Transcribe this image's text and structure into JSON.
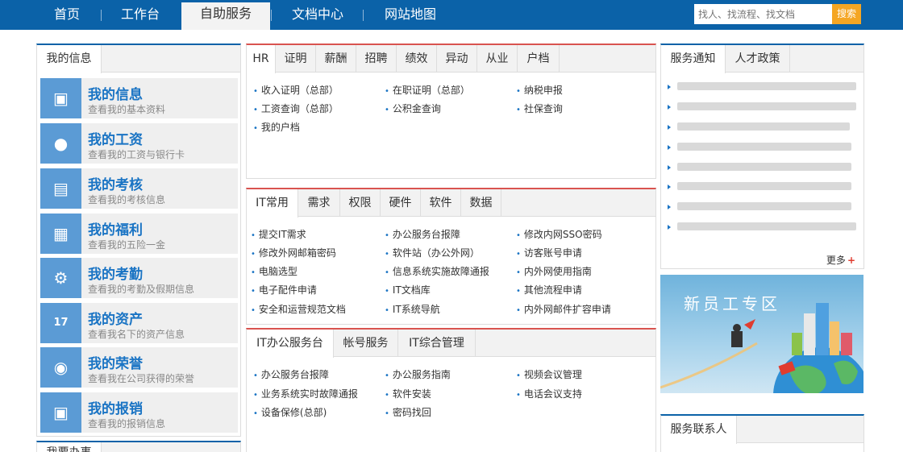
{
  "nav": {
    "items": [
      "首页",
      "工作台",
      "自助服务",
      "文档中心",
      "网站地图"
    ],
    "search_placeholder": "找人、找流程、找文档",
    "search_button": "搜索"
  },
  "left": {
    "tab": "我的信息",
    "cards": [
      {
        "title": "我的信息",
        "sub": "查看我的基本资料",
        "icon": "briefcase-icon"
      },
      {
        "title": "我的工资",
        "sub": "查看我的工资与银行卡",
        "icon": "people-icon"
      },
      {
        "title": "我的考核",
        "sub": "查看我的考核信息",
        "icon": "inbox-icon"
      },
      {
        "title": "我的福利",
        "sub": "查看我的五险一金",
        "icon": "book-icon"
      },
      {
        "title": "我的考勤",
        "sub": "查看我的考勤及假期信息",
        "icon": "gear-icon"
      },
      {
        "title": "我的资产",
        "sub": "查看我名下的资产信息",
        "icon": "calendar-icon"
      },
      {
        "title": "我的荣誉",
        "sub": "查看我在公司获得的荣誉",
        "icon": "globe-icon"
      },
      {
        "title": "我的报销",
        "sub": "查看我的报销信息",
        "icon": "briefcase-icon"
      }
    ],
    "bottom_tab": "我要办事"
  },
  "hr": {
    "tabs": [
      "HR",
      "证明",
      "薪酬",
      "招聘",
      "绩效",
      "异动",
      "从业",
      "户档"
    ],
    "links": [
      [
        "收入证明（总部）",
        "在职证明（总部）",
        "纳税申报"
      ],
      [
        "工资查询（总部）",
        "公积金查询",
        "社保查询"
      ],
      [
        "我的户档"
      ]
    ]
  },
  "it": {
    "tabs": [
      "IT常用",
      "需求",
      "权限",
      "硬件",
      "软件",
      "数据"
    ],
    "links": [
      [
        "提交IT需求",
        "办公服务台报障",
        "修改内网SSO密码"
      ],
      [
        "修改外网邮箱密码",
        "软件站（办公外网）",
        "访客账号申请"
      ],
      [
        "电脑选型",
        "信息系统实施故障通报",
        "内外网使用指南"
      ],
      [
        "电子配件申请",
        "IT文档库",
        "其他流程申请"
      ],
      [
        "安全和运营规范文档",
        "IT系统导航",
        "内外网邮件扩容申请"
      ]
    ]
  },
  "desk": {
    "tabs": [
      "IT办公服务台",
      "帐号服务",
      "IT综合管理"
    ],
    "links": [
      [
        "办公服务台报障",
        "办公服务指南",
        "视频会议管理"
      ],
      [
        "业务系统实时故障通报",
        "软件安装",
        "电话会议支持"
      ],
      [
        "设备保修(总部)",
        "密码找回"
      ]
    ]
  },
  "notices": {
    "tabs": [
      "服务通知",
      "人才政策"
    ],
    "more": "更多",
    "count": 8
  },
  "banner": {
    "text": "新员工专区"
  },
  "contact": {
    "tab": "服务联系人"
  }
}
